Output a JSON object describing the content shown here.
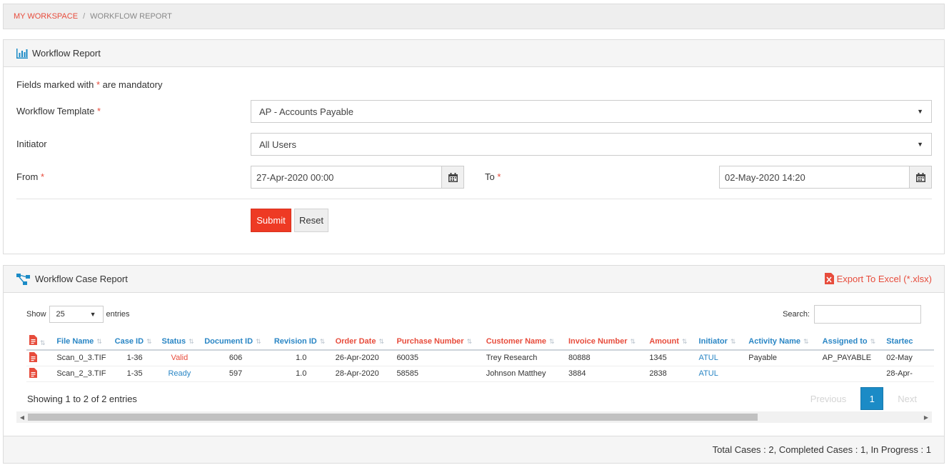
{
  "breadcrumb": {
    "home": "MY WORKSPACE",
    "separator": "/",
    "current": "WORKFLOW REPORT"
  },
  "report_panel": {
    "title": "Workflow Report",
    "mandatory_note_prefix": "Fields marked with ",
    "mandatory_note_star": "*",
    "mandatory_note_suffix": " are mandatory",
    "template_label": "Workflow Template",
    "template_value": "AP - Accounts Payable",
    "initiator_label": "Initiator",
    "initiator_value": "All Users",
    "from_label": "From",
    "from_value": "27-Apr-2020 00:00",
    "to_label": "To",
    "to_value": "02-May-2020 14:20",
    "required_mark": "*",
    "submit_label": "Submit",
    "reset_label": "Reset"
  },
  "case_panel": {
    "title": "Workflow Case Report",
    "export_label": "Export To Excel (*.xlsx)",
    "show_label": "Show",
    "page_length": "25",
    "entries_label": "entries",
    "search_label": "Search:",
    "search_value": "",
    "columns": [
      "File Name",
      "Case ID",
      "Status",
      "Document ID",
      "Revision ID",
      "Order Date",
      "Purchase Number",
      "Customer Name",
      "Invoice Number",
      "Amount",
      "Initiator",
      "Activity Name",
      "Assigned to",
      "Startec"
    ],
    "rows": [
      {
        "file_name": "Scan_0_3.TIF",
        "case_id": "1-36",
        "status": "Valid",
        "document_id": "606",
        "revision_id": "1.0",
        "order_date": "26-Apr-2020",
        "purchase_number": "60035",
        "customer_name": "Trey Research",
        "invoice_number": "80888",
        "amount": "1345",
        "initiator": "ATUL",
        "activity_name": "Payable",
        "assigned_to": "AP_PAYABLE",
        "started": "02-May"
      },
      {
        "file_name": "Scan_2_3.TIF",
        "case_id": "1-35",
        "status": "Ready",
        "document_id": "597",
        "revision_id": "1.0",
        "order_date": "28-Apr-2020",
        "purchase_number": "58585",
        "customer_name": "Johnson Matthey",
        "invoice_number": "3884",
        "amount": "2838",
        "initiator": "ATUL",
        "activity_name": "",
        "assigned_to": "",
        "started": "28-Apr-"
      }
    ],
    "info": "Showing 1 to 2 of 2 entries",
    "pager": {
      "previous": "Previous",
      "current": "1",
      "next": "Next"
    },
    "summary": "Total Cases : 2, Completed Cases : 1, In Progress : 1"
  },
  "colors": {
    "accent_red": "#ee3a24",
    "link_blue": "#2a86c5",
    "page_active": "#1b8bc6"
  }
}
